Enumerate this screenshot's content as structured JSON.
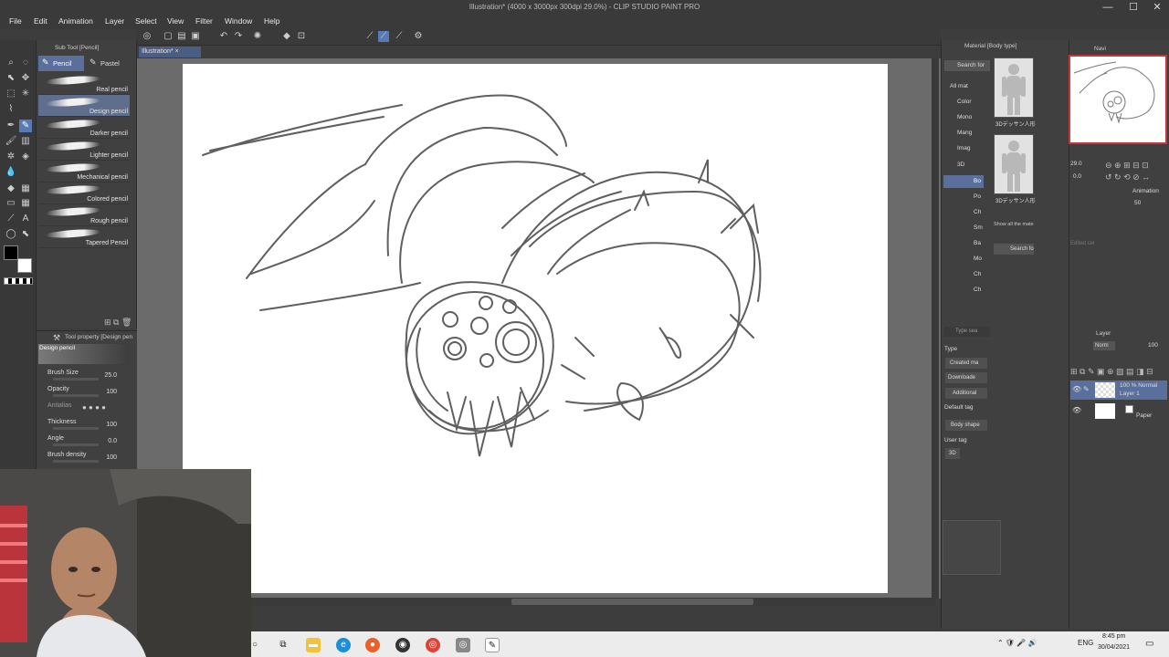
{
  "window": {
    "title": "Illustration* (4000 x 3000px 300dpi 29.0%) - CLIP STUDIO PAINT PRO",
    "minimize": "—",
    "maximize": "☐",
    "close": "✕"
  },
  "menu": [
    "File",
    "Edit",
    "Animation",
    "Layer",
    "Select",
    "View",
    "Filter",
    "Window",
    "Help"
  ],
  "document_tab": "Illustration*",
  "sub_tool": {
    "header": "Sub Tool [Pencil]",
    "tabs": [
      "Pencil",
      "Pastel"
    ],
    "brushes": [
      "Real pencil",
      "Design pencil",
      "Darker pencil",
      "Lighter pencil",
      "Mechanical pencil",
      "Colored pencil",
      "Rough pencil",
      "Tapered Pencil"
    ],
    "selected_brush": "Design pencil"
  },
  "tool_property": {
    "header": "Tool property [Design pen",
    "preset": "Design pencil",
    "rows": [
      {
        "label": "Brush Size",
        "value": "25.0"
      },
      {
        "label": "Opacity",
        "value": "100"
      },
      {
        "label": "Antialias",
        "value": ""
      },
      {
        "label": "Thickness",
        "value": "100"
      },
      {
        "label": "Angle",
        "value": "0.0"
      },
      {
        "label": "Brush density",
        "value": "100"
      }
    ]
  },
  "materials": {
    "header": "Material [Body type]",
    "search": "Search for",
    "tree": [
      "All mat",
      "Color",
      "Mono",
      "Mang",
      "Imag",
      "3D",
      "Bo",
      "Po",
      "Ch",
      "Sm",
      "Ba",
      "Mo",
      "Ch",
      "Ch"
    ],
    "thumb_labels": [
      "3Dデッサン人形",
      "3Dデッサン人形"
    ],
    "show_all": "Show all the mate",
    "search_btn": "Search fo",
    "tag_search": "Type sea",
    "type_label": "Type",
    "type_items": [
      "Created ma",
      "Downloade",
      "Additional"
    ],
    "default_tag_label": "Default tag",
    "default_tag": "Body shape",
    "user_tag_label": "User tag",
    "user_tag": "3D"
  },
  "navigator": {
    "header": "Navi",
    "zoom": "29.0",
    "angle": "0.0"
  },
  "animation_panel": {
    "tab": "Animation",
    "value": "50",
    "edited_cel": "Edited cel"
  },
  "layer_panel": {
    "header": "Layer",
    "blend": "Norm",
    "opacity": "100",
    "layers": [
      {
        "name": "Layer 1",
        "info": "100 % Normal"
      },
      {
        "name": "Paper",
        "info": ""
      }
    ]
  },
  "taskbar": {
    "language": "ENG",
    "time": "8:45 pm",
    "date": "30/04/2021"
  }
}
